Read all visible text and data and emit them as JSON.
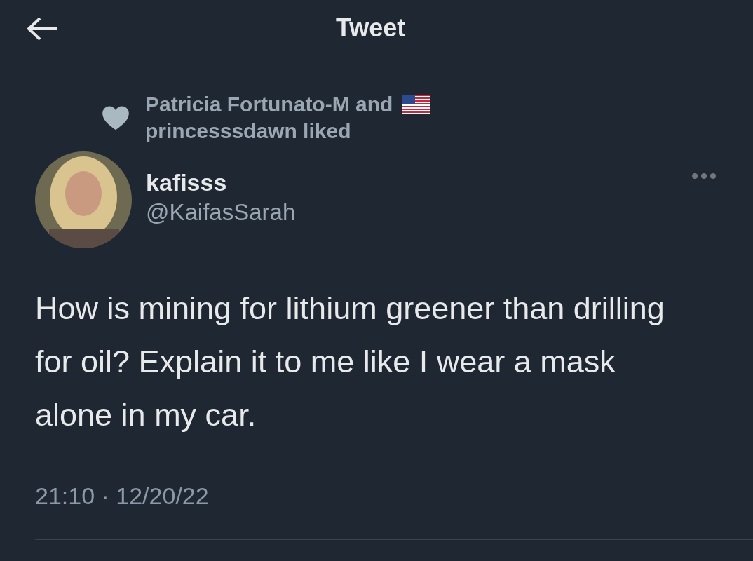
{
  "header": {
    "title": "Tweet"
  },
  "social_context": {
    "line_1": "Patricia Fortunato-M and",
    "line_2": "princesssdawn liked"
  },
  "author": {
    "name": "kafisss",
    "handle": "@KaifasSarah"
  },
  "tweet": {
    "text": "How is mining for lithium greener than drilling for oil?  Explain it to me like I wear a mask alone in my car.",
    "timestamp": "21:10 · 12/20/22"
  }
}
